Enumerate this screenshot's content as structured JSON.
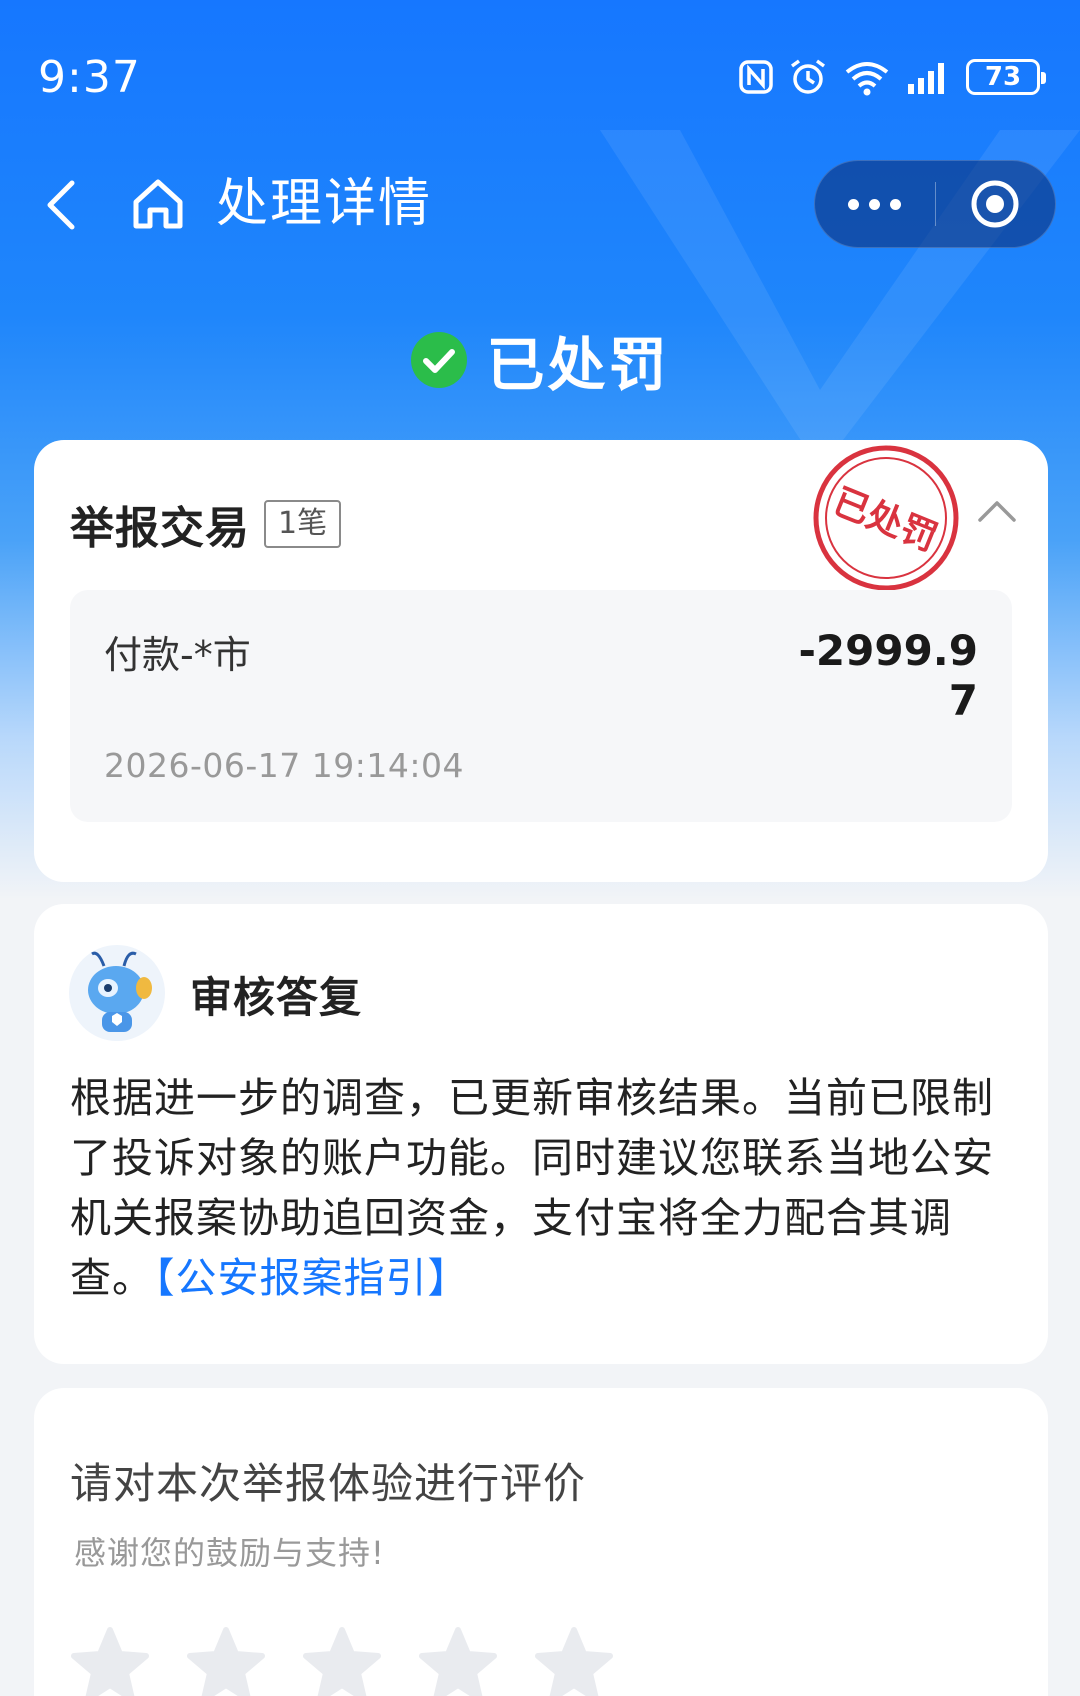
{
  "status_bar": {
    "time": "9:37",
    "battery": "73",
    "icons": [
      "nfc-icon",
      "alarm-icon",
      "wifi-icon",
      "signal-icon",
      "battery-icon"
    ]
  },
  "nav": {
    "title": "处理详情",
    "back_icon": "chevron-left-icon",
    "home_icon": "home-icon",
    "more_icon": "more-dots-icon",
    "close_icon": "target-close-icon"
  },
  "status": {
    "text": "已处罚",
    "icon": "check-circle-icon",
    "icon_color": "#2bbd4a"
  },
  "report": {
    "title": "举报交易",
    "count_badge": "1笔",
    "stamp_text": "已处罚",
    "stamp_color": "#d9333f",
    "transaction": {
      "name": "付款-*市",
      "amount": "-2999.97",
      "time": "2026-06-17 19:14:04"
    }
  },
  "reply": {
    "title": "审核答复",
    "body": "根据进一步的调查，已更新审核结果。当前已限制了投诉对象的账户功能。同时建议您联系当地公安机关报案协助追回资金，支付宝将全力配合其调查。",
    "link_text": "【公安报案指引】",
    "link_color": "#1677ff"
  },
  "rating": {
    "title": "请对本次举报体验进行评价",
    "subtitle": "感谢您的鼓励与支持!",
    "stars_filled": 0,
    "stars_total": 5
  },
  "colors": {
    "primary_blue": "#1677ff",
    "background": "#f2f4f7"
  }
}
